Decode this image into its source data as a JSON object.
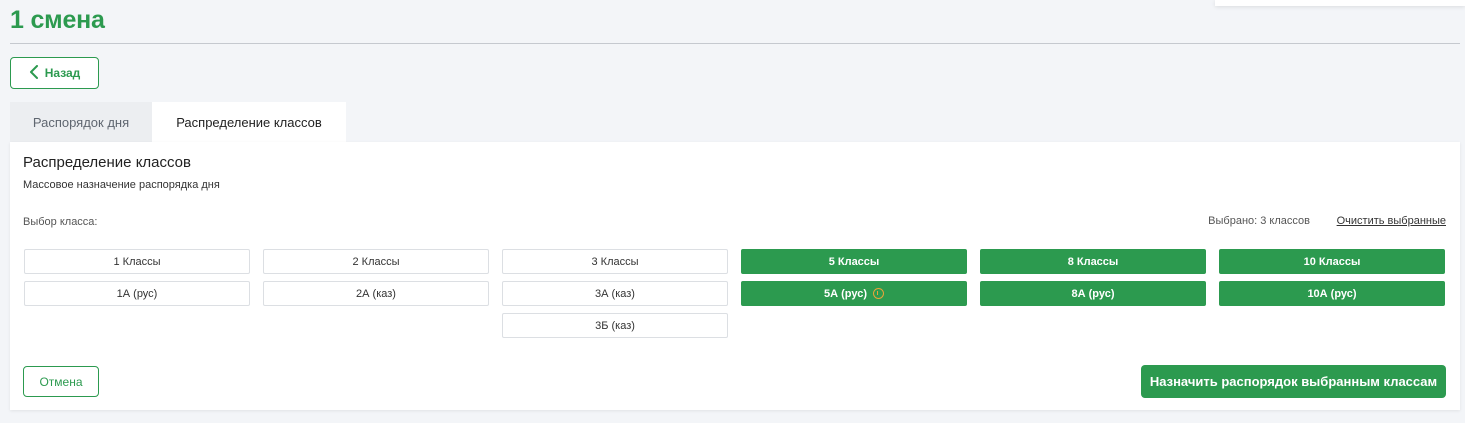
{
  "page": {
    "title": "1 смена"
  },
  "back_button": {
    "label": "Назад"
  },
  "tabs": [
    {
      "label": "Распорядок дня",
      "active": false
    },
    {
      "label": "Распределение классов",
      "active": true
    }
  ],
  "panel": {
    "title": "Распределение классов",
    "subtitle": "Массовое назначение распорядка дня",
    "pick_label": "Выбор класса:",
    "selected_count": "Выбрано: 3 классов",
    "clear_selected": "Очистить выбранные",
    "cancel_label": "Отмена",
    "assign_label": "Назначить распорядок выбранным классам"
  },
  "class_groups": [
    {
      "header": "1 Классы",
      "selected": false,
      "classes": [
        {
          "label": "1А (рус)",
          "selected": false
        }
      ]
    },
    {
      "header": "2 Классы",
      "selected": false,
      "classes": [
        {
          "label": "2А (каз)",
          "selected": false
        }
      ]
    },
    {
      "header": "3 Классы",
      "selected": false,
      "classes": [
        {
          "label": "3А (каз)",
          "selected": false
        },
        {
          "label": "3Б (каз)",
          "selected": false
        }
      ]
    },
    {
      "header": "5 Классы",
      "selected": true,
      "classes": [
        {
          "label": "5А (рус)",
          "selected": true,
          "warning": true
        }
      ]
    },
    {
      "header": "8 Классы",
      "selected": true,
      "classes": [
        {
          "label": "8А (рус)",
          "selected": true
        }
      ]
    },
    {
      "header": "10 Классы",
      "selected": true,
      "classes": [
        {
          "label": "10А (рус)",
          "selected": true
        }
      ]
    }
  ],
  "colors": {
    "accent": "#2c9a4f",
    "warning": "#e8a33a"
  },
  "icons": {
    "back": "chevron-left-icon",
    "warning": "warning-circle-icon"
  }
}
